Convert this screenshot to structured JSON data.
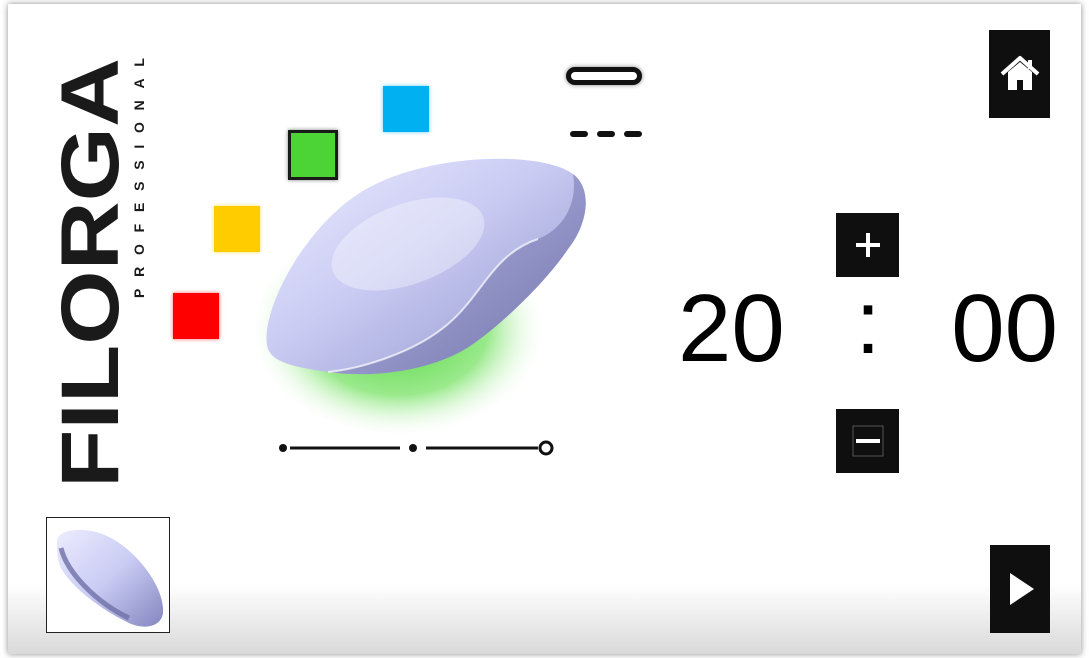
{
  "brand": {
    "name": "FILORGA",
    "tagline": "PROFESSIONAL"
  },
  "color_options": [
    {
      "name": "red",
      "color": "#ff0000"
    },
    {
      "name": "yellow",
      "color": "#ffcc00"
    },
    {
      "name": "green",
      "color": "#4cd437",
      "selected": true
    },
    {
      "name": "blue",
      "color": "#00b0f0"
    }
  ],
  "intensity_options": [
    {
      "name": "continuous"
    },
    {
      "name": "pulsed"
    }
  ],
  "level_options": {
    "count": 3,
    "selected_index": 2
  },
  "timer": {
    "minutes": "20",
    "separator": ":",
    "seconds": "00"
  },
  "icons": {
    "home": "home-icon",
    "increase": "plus-icon",
    "decrease": "minus-icon",
    "play": "play-icon"
  },
  "colors": {
    "button_background": "#0f0f0f",
    "glow": "#4cd437",
    "device": "#c6c8ee"
  }
}
